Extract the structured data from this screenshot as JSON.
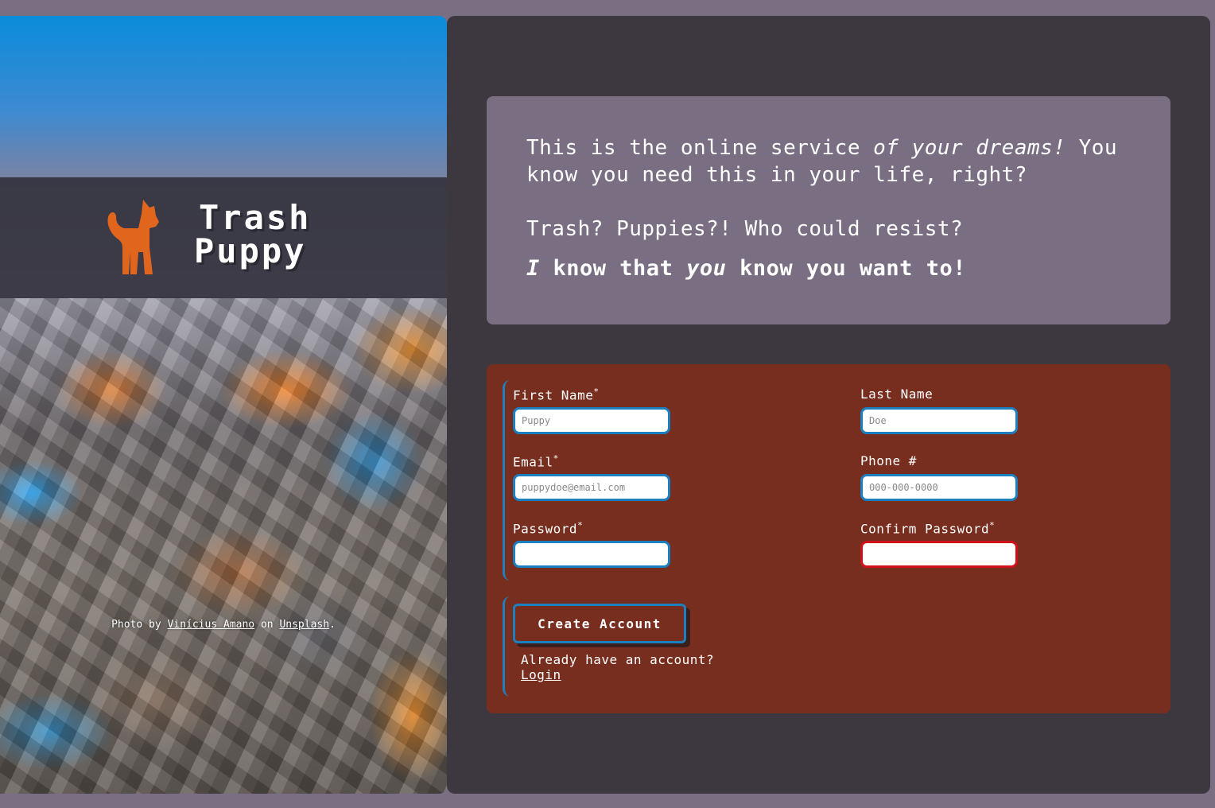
{
  "brand": {
    "name_line1": "Trash",
    "name_line2": "Puppy",
    "logo_icon": "dog-silhouette-icon",
    "logo_color": "#e0661e"
  },
  "photo_credit": {
    "prefix": "Photo by",
    "author": "Vinícius Amano",
    "middle": "on",
    "site": "Unsplash",
    "suffix": "."
  },
  "intro": {
    "p1_part1": "This is the online service ",
    "p1_em": "of your dreams!",
    "p1_part2": " You know you need this in your life, right?",
    "p2": "Trash? Puppies?! Who could resist?",
    "p3_em1": "I",
    "p3_part1": " know that ",
    "p3_em2": "you",
    "p3_part2": " know you want to!"
  },
  "form": {
    "first_name": {
      "label": "First Name",
      "required_mark": "*",
      "placeholder": "Puppy"
    },
    "last_name": {
      "label": "Last Name",
      "placeholder": "Doe"
    },
    "email": {
      "label": "Email",
      "required_mark": "*",
      "placeholder": "puppydoe@email.com"
    },
    "phone": {
      "label": "Phone #",
      "placeholder": "000-000-0000"
    },
    "password": {
      "label": "Password",
      "required_mark": "*",
      "placeholder": ""
    },
    "confirm_password": {
      "label": "Confirm Password",
      "required_mark": "*",
      "placeholder": ""
    },
    "submit_label": "Create Account",
    "already_text": "Already have an account?",
    "login_link": "Login"
  },
  "colors": {
    "page_bg": "#7a6f82",
    "panel_bg": "#3d3840",
    "form_bg": "#782e1f",
    "accent_blue": "#1c7fbf",
    "error_red": "#d0101a"
  }
}
